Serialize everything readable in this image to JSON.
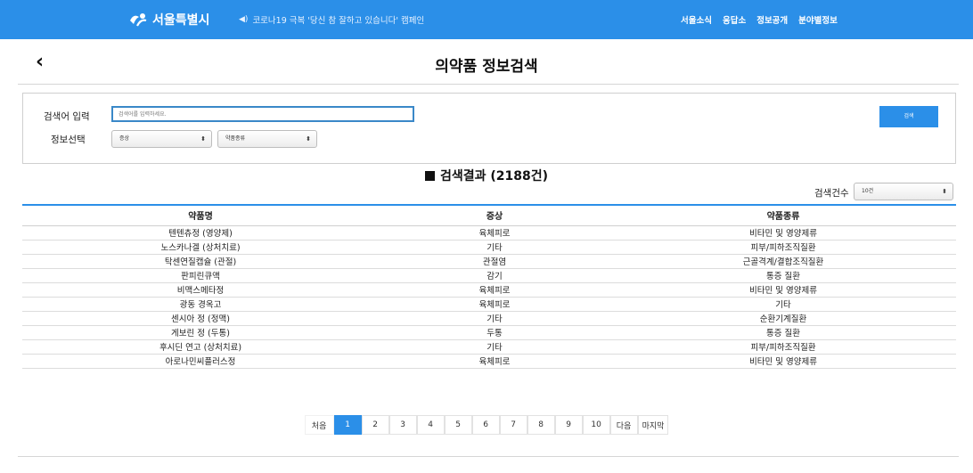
{
  "header": {
    "logo_text": "서울특별시",
    "campaign_text": "코로나19 극복 '당신 참 잘하고 있습니다' 캠페인",
    "nav": [
      "서울소식",
      "응답소",
      "정보공개",
      "분야별정보"
    ],
    "brand_color": "#2b8fe8"
  },
  "page": {
    "title": "의약품 정보검색",
    "back_icon": "‹"
  },
  "search": {
    "keyword_label": "검색어 입력",
    "keyword_placeholder": "검색어를 입력하세요.",
    "keyword_value": "",
    "info_label": "정보선택",
    "symptom_select": "증상",
    "kind_select": "약품종류",
    "button_label": "검색"
  },
  "results": {
    "heading": "검색결과 (2188건)",
    "count_label": "검색건수",
    "count_select": "10건",
    "columns": [
      "약품명",
      "증상",
      "약품종류"
    ],
    "rows": [
      [
        "텐텐츄정 (영양제)",
        "육체피로",
        "비타민 및 영양제류"
      ],
      [
        "노스카나겔 (상처치료)",
        "기타",
        "피부/피하조직질환"
      ],
      [
        "탁센연질캡슐 (관절)",
        "관절염",
        "근골격계/결합조직질환"
      ],
      [
        "판피린큐액",
        "감기",
        "통증 질환"
      ],
      [
        "비맥스메타정",
        "육체피로",
        "비타민 및 영양제류"
      ],
      [
        "광동 경옥고",
        "육체피로",
        "기타"
      ],
      [
        "센시아 정 (정맥)",
        "기타",
        "순환기계질환"
      ],
      [
        "게보린 정 (두통)",
        "두통",
        "통증 질환"
      ],
      [
        "후시딘 연고 (상처치료)",
        "기타",
        "피부/피하조직질환"
      ],
      [
        "아로나민씨플러스정",
        "육체피로",
        "비타민 및 영양제류"
      ]
    ]
  },
  "pagination": {
    "first": "처음",
    "pages": [
      "1",
      "2",
      "3",
      "4",
      "5",
      "6",
      "7",
      "8",
      "9",
      "10"
    ],
    "active_page": "1",
    "next": "다음",
    "last": "마지막"
  }
}
